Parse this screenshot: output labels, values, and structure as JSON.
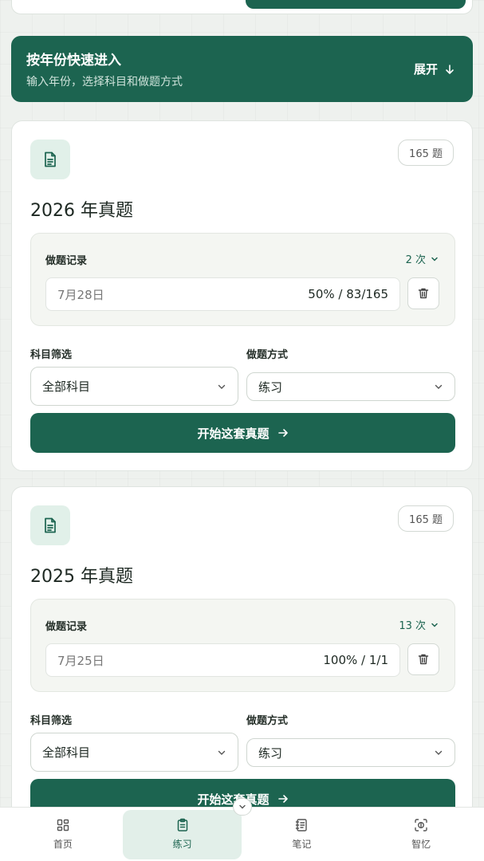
{
  "banner": {
    "title": "按年份快速进入",
    "subtitle": "输入年份，选择科目和做题方式",
    "expand_label": "展开"
  },
  "cards": [
    {
      "count": "165 题",
      "title": "2026 年真题",
      "record_label": "做题记录",
      "times": "2 次",
      "record_date": "7月28日",
      "record_progress": "50% / 83/165",
      "subject_label": "科目筛选",
      "subject_value": "全部科目",
      "mode_label": "做题方式",
      "mode_value": "练习",
      "start_label": "开始这套真题"
    },
    {
      "count": "165 题",
      "title": "2025 年真题",
      "record_label": "做题记录",
      "times": "13 次",
      "record_date": "7月25日",
      "record_progress": "100% / 1/1",
      "subject_label": "科目筛选",
      "subject_value": "全部科目",
      "mode_label": "做题方式",
      "mode_value": "练习",
      "start_label": "开始这套真题"
    }
  ],
  "nav": {
    "items": [
      {
        "label": "首页",
        "icon": "grid-icon"
      },
      {
        "label": "练习",
        "icon": "clipboard-icon"
      },
      {
        "label": "笔记",
        "icon": "notebook-icon"
      },
      {
        "label": "智忆",
        "icon": "scan-brain-icon"
      }
    ],
    "active": "练习"
  },
  "colors": {
    "brand": "#1c6450",
    "brand_light": "#e1f0e9",
    "background": "#eef1ee"
  }
}
